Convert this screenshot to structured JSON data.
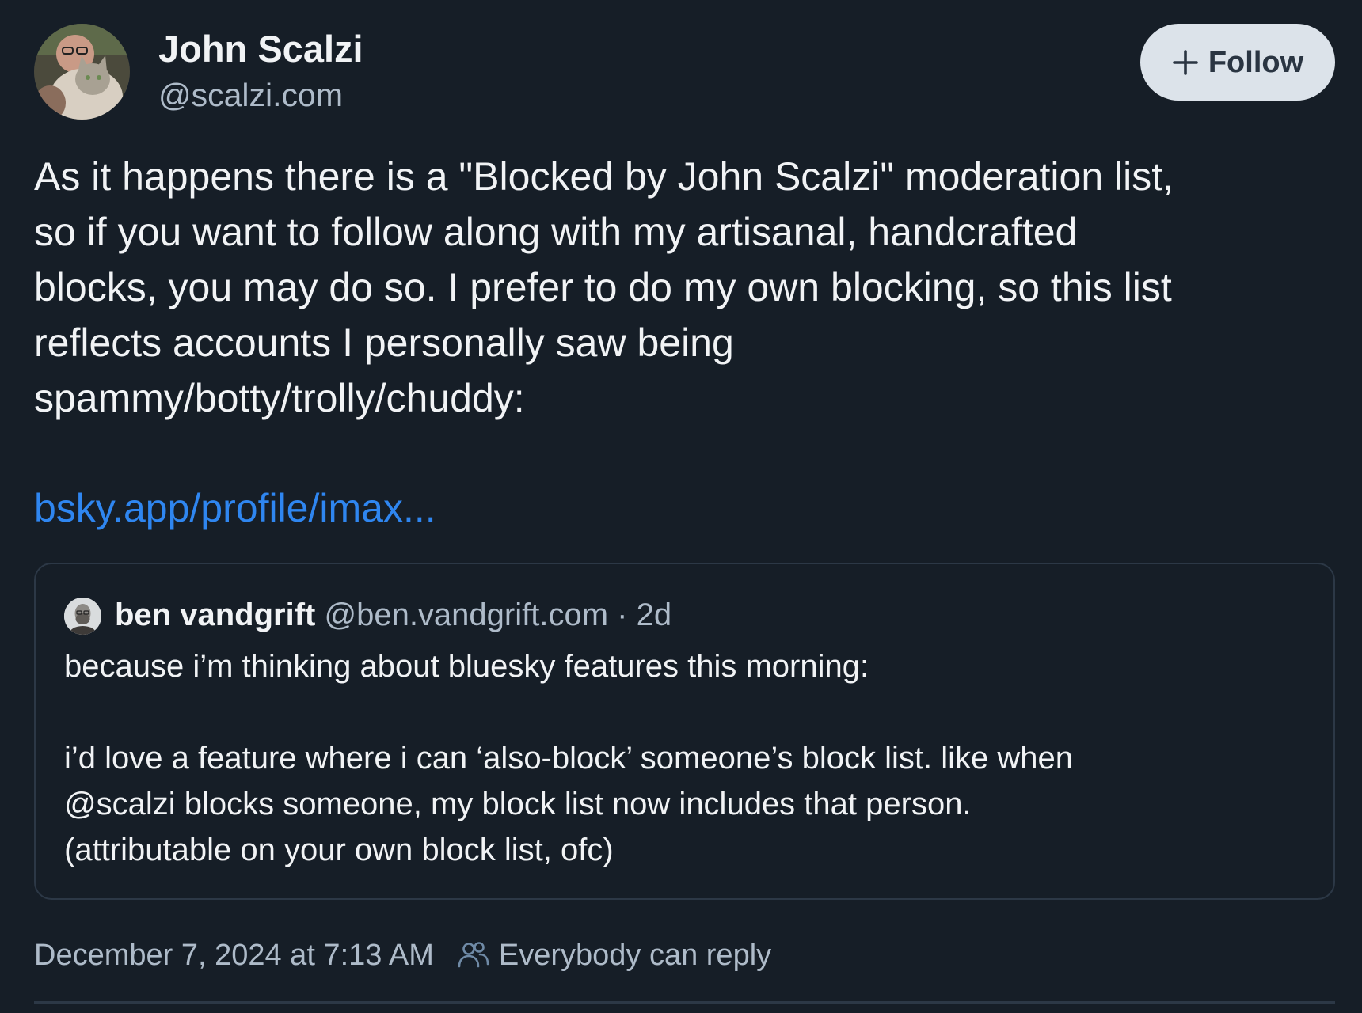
{
  "author": {
    "name": "John Scalzi",
    "handle": "@scalzi.com",
    "avatar_icon": "user-avatar-with-cat"
  },
  "follow_button": {
    "label": "Follow",
    "icon": "plus-icon"
  },
  "post": {
    "text_lines": [
      "As it happens there is a \"Blocked by John Scalzi\" moderation list,",
      "so if you want to follow along with my artisanal, handcrafted",
      "blocks, you may do so. I prefer to do my own blocking, so this list",
      "reflects accounts I personally saw being",
      "spammy/botty/trolly/chuddy:"
    ],
    "link": "bsky.app/profile/imax..."
  },
  "quote": {
    "author": "ben vandgrift",
    "handle": "@ben.vandgrift.com",
    "separator": "·",
    "age": "2d",
    "avatar_icon": "quoted-user-avatar",
    "body_line_1": "because i’m thinking about bluesky features this morning:",
    "body_lines": [
      "i’d love a feature where i can ‘also-block’ someone’s block list. like when",
      "@scalzi blocks someone, my block list now includes that person.",
      "(attributable on your own block list, ofc)"
    ]
  },
  "meta": {
    "timestamp": "December 7, 2024 at 7:13 AM",
    "reply_setting": "Everybody can reply",
    "reply_icon": "people-icon"
  },
  "colors": {
    "background": "#161e27",
    "link": "#2f86f0",
    "muted": "#aebbc9",
    "follow_bg": "#dce3ea"
  }
}
